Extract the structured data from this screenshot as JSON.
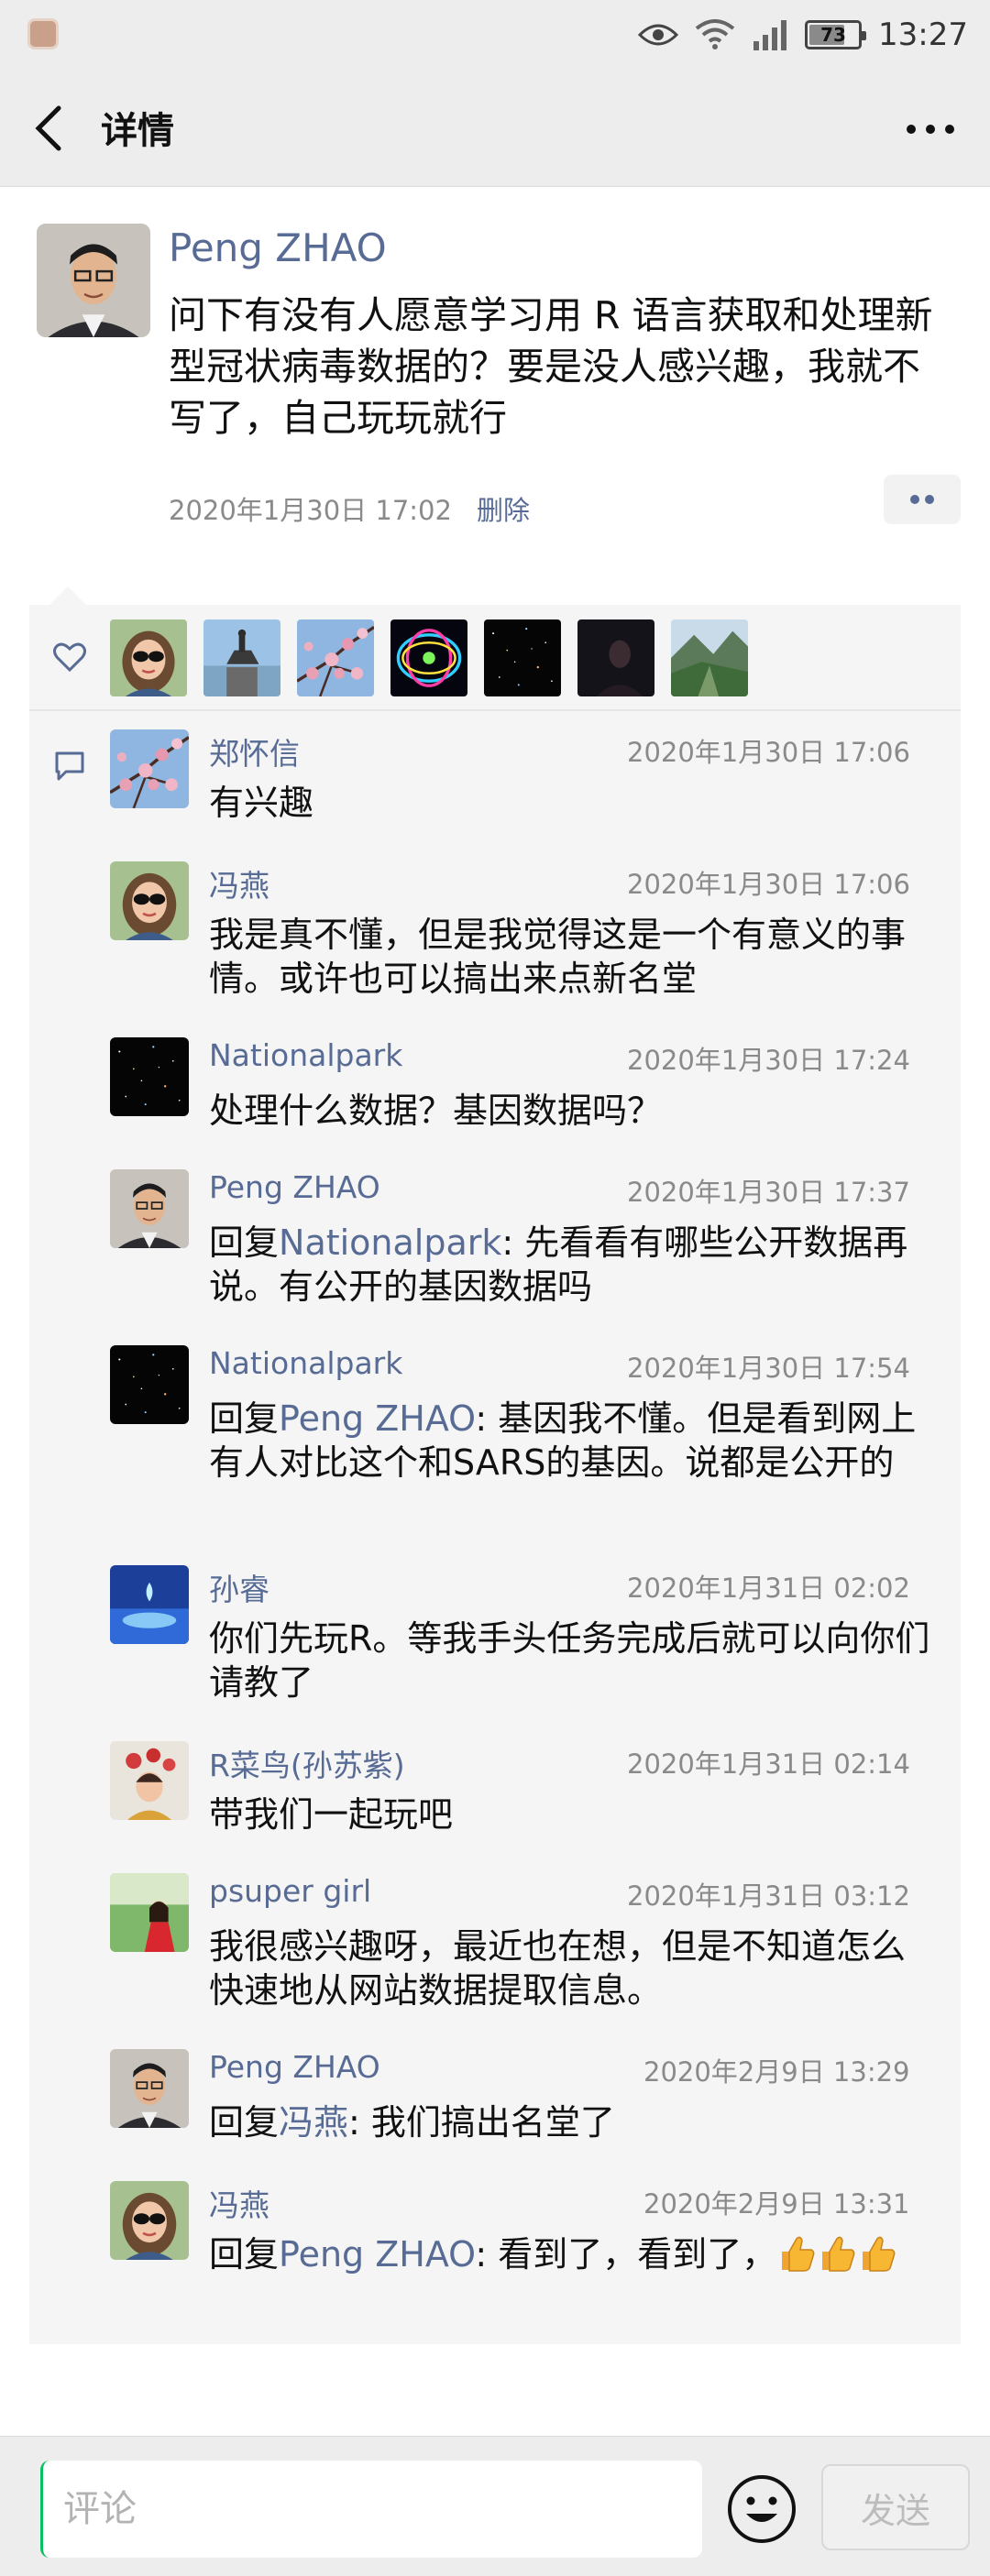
{
  "status_bar": {
    "time": "13:27",
    "battery": "73",
    "battery_fraction": 0.73
  },
  "header": {
    "title": "详情"
  },
  "post": {
    "author": "Peng ZHAO",
    "text": "问下有没有人愿意学习用 R 语言获取和处理新型冠状病毒数据的？要是没人感兴趣，我就不写了，自己玩玩就行",
    "time": "2020年1月30日 17:02",
    "delete_label": "删除"
  },
  "likes": {
    "avatars": [
      "avatar-sunglasses-woman",
      "avatar-equestrian-statue",
      "avatar-plum-blossom",
      "avatar-neon-rings",
      "avatar-starfield",
      "avatar-dark-portrait",
      "avatar-mountain-valley"
    ]
  },
  "comments": [
    {
      "name": "郑怀信",
      "time": "2020年1月30日 17:06",
      "text": "有兴趣",
      "avatar": "avatar-plum-blossom"
    },
    {
      "name": "冯燕",
      "time": "2020年1月30日 17:06",
      "text": "我是真不懂，但是我觉得这是一个有意义的事情。或许也可以搞出来点新名堂",
      "avatar": "avatar-sunglasses-woman"
    },
    {
      "name": "Nationalpark",
      "time": "2020年1月30日 17:24",
      "text": "处理什么数据？基因数据吗？",
      "avatar": "avatar-starfield"
    },
    {
      "name": "Peng ZHAO",
      "time": "2020年1月30日 17:37",
      "reply_prefix": "回复",
      "reply_to": "Nationalpark",
      "text": ": 先看看有哪些公开数据再说。有公开的基因数据吗",
      "avatar": "avatar-man-glasses"
    },
    {
      "name": "Nationalpark",
      "time": "2020年1月30日 17:54",
      "reply_prefix": "回复",
      "reply_to": "Peng ZHAO",
      "text": ": 基因我不懂。但是看到网上有人对比这个和SARS的基因。说都是公开的",
      "avatar": "avatar-starfield"
    },
    {
      "name": "孙睿",
      "time": "2020年1月31日 02:02",
      "text": "你们先玩R。等我手头任务完成后就可以向你们请教了",
      "avatar": "avatar-blue-water"
    },
    {
      "name": "R菜鸟(孙苏紫)",
      "time": "2020年1月31日 02:14",
      "text": "带我们一起玩吧",
      "avatar": "avatar-child-red"
    },
    {
      "name": "psuper girl",
      "time": "2020年1月31日 03:12",
      "text": "我很感兴趣呀，最近也在想，但是不知道怎么快速地从网站数据提取信息。",
      "avatar": "avatar-girl-garden"
    },
    {
      "name": "Peng ZHAO",
      "time": "2020年2月9日 13:29",
      "reply_prefix": "回复",
      "reply_to": "冯燕",
      "text": ": 我们搞出名堂了",
      "avatar": "avatar-man-glasses"
    },
    {
      "name": "冯燕",
      "time": "2020年2月9日 13:31",
      "reply_prefix": "回复",
      "reply_to": "Peng ZHAO",
      "text": ": 看到了，看到了，",
      "emoji": [
        "thumbs-up-icon",
        "thumbs-up-icon",
        "thumbs-up-icon"
      ],
      "avatar": "avatar-sunglasses-woman"
    }
  ],
  "bottom_bar": {
    "placeholder": "评论",
    "send_label": "发送"
  },
  "colors": {
    "link": "#576b95",
    "panel": "#f5f5f5",
    "bar": "#ededed",
    "accent": "#07c160"
  }
}
